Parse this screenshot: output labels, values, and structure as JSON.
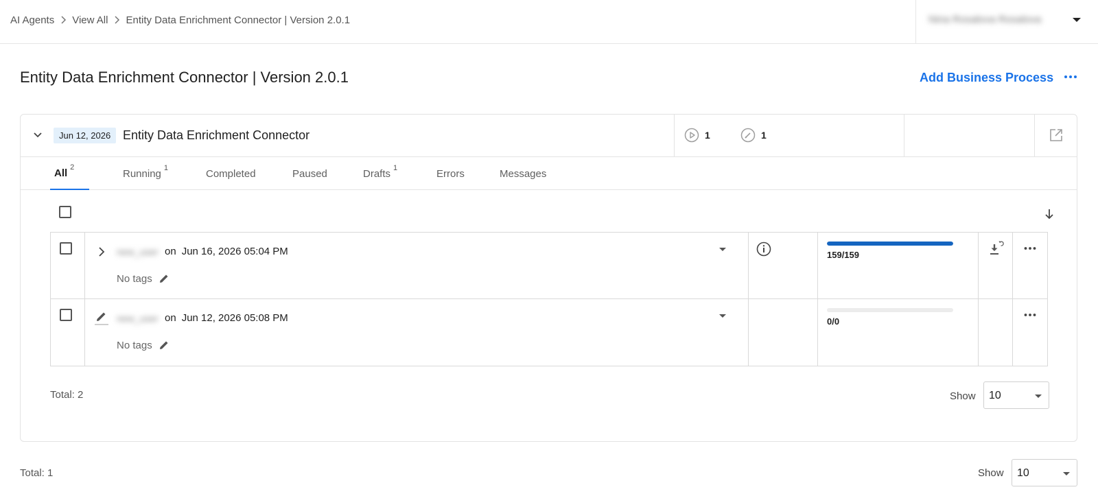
{
  "breadcrumb": {
    "items": [
      "AI Agents",
      "View All",
      "Entity Data Enrichment Connector | Version 2.0.1"
    ]
  },
  "user": {
    "name": "Nina Rosalova Rosalova"
  },
  "page": {
    "title": "Entity Data Enrichment Connector | Version 2.0.1",
    "add_button": "Add Business Process"
  },
  "card": {
    "date": "Jun 12, 2026",
    "title": "Entity Data Enrichment Connector",
    "stats": {
      "running": "1",
      "drafts": "1"
    }
  },
  "tabs": [
    {
      "label": "All",
      "count": "2"
    },
    {
      "label": "Running",
      "count": "1"
    },
    {
      "label": "Completed",
      "count": ""
    },
    {
      "label": "Paused",
      "count": ""
    },
    {
      "label": "Drafts",
      "count": "1"
    },
    {
      "label": "Errors",
      "count": ""
    },
    {
      "label": "Messages",
      "count": ""
    }
  ],
  "rows": [
    {
      "author": "new_user",
      "on": "on",
      "datetime": "Jun 16, 2026 05:04 PM",
      "tags": "No tags",
      "progress_text": "159/159",
      "progress_fraction": 1.0
    },
    {
      "author": "new_user",
      "on": "on",
      "datetime": "Jun 12, 2026 05:08 PM",
      "tags": "No tags",
      "progress_text": "0/0",
      "progress_fraction": 0
    }
  ],
  "inner_footer": {
    "total": "Total: 2",
    "show_label": "Show",
    "show_value": "10"
  },
  "outer_footer": {
    "total": "Total: 1",
    "show_label": "Show",
    "show_value": "10"
  },
  "colors": {
    "accent": "#1a73e8",
    "progress": "#1565c0",
    "date_chip_bg": "#e3f0fb"
  },
  "icons": {
    "breadcrumb_separator": "chevron-right-icon",
    "card_toggle": "chevron-down-icon",
    "running_stat": "play-circle-icon",
    "draft_stat": "edit-circle-icon",
    "open_external": "open-in-new-icon",
    "sort": "arrow-down-icon",
    "row_expand": "chevron-right-icon",
    "row_draft": "pencil-icon",
    "info": "info-icon",
    "download": "download-icon",
    "more": "more-horizontal-icon"
  }
}
